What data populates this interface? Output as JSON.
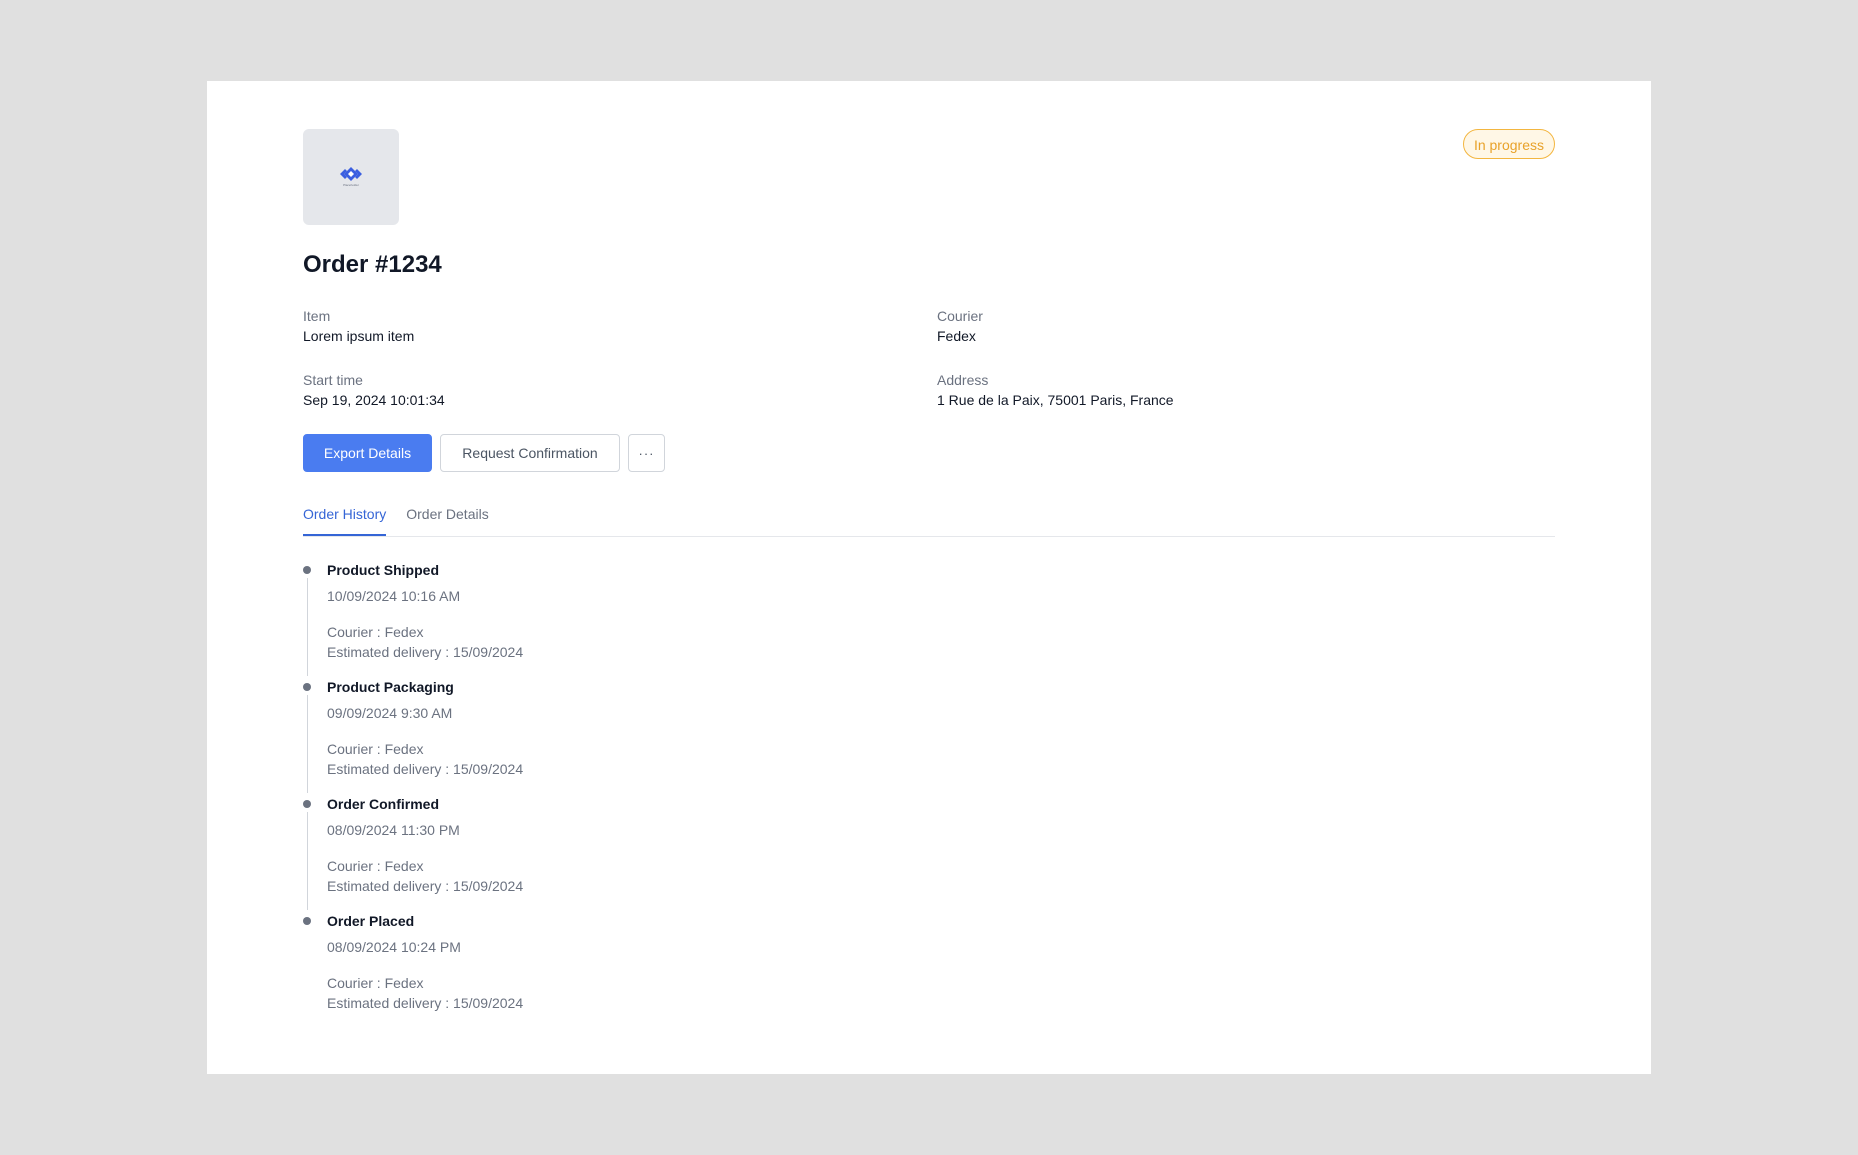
{
  "order": {
    "title": "Order #1234",
    "status": "In progress",
    "logo_name": "logo-icon",
    "logo_wordmark": "Placeholder"
  },
  "details": {
    "item_label": "Item",
    "item_value": "Lorem ipsum item",
    "courier_label": "Courier",
    "courier_value": "Fedex",
    "start_time_label": "Start time",
    "start_time_value": "Sep 19, 2024 10:01:34",
    "address_label": "Address",
    "address_value": "1 Rue de la Paix, 75001 Paris, France"
  },
  "actions": {
    "export_label": "Export Details",
    "request_label": "Request Confirmation",
    "more_label": "···"
  },
  "tabs": [
    {
      "label": "Order History",
      "active": true
    },
    {
      "label": "Order Details",
      "active": false
    }
  ],
  "timeline": [
    {
      "title": "Product Shipped",
      "time": "10/09/2024 10:16 AM",
      "courier": "Courier : Fedex",
      "delivery": "Estimated delivery : 15/09/2024"
    },
    {
      "title": "Product Packaging",
      "time": "09/09/2024 9:30 AM",
      "courier": "Courier : Fedex",
      "delivery": "Estimated delivery : 15/09/2024"
    },
    {
      "title": "Order Confirmed",
      "time": "08/09/2024 11:30 PM",
      "courier": "Courier : Fedex",
      "delivery": "Estimated delivery : 15/09/2024"
    },
    {
      "title": "Order Placed",
      "time": "08/09/2024 10:24 PM",
      "courier": "Courier : Fedex",
      "delivery": "Estimated delivery : 15/09/2024"
    }
  ],
  "colors": {
    "accent": "#4a7cf0",
    "status_text": "#e8a22a",
    "status_border": "#f3b640"
  }
}
